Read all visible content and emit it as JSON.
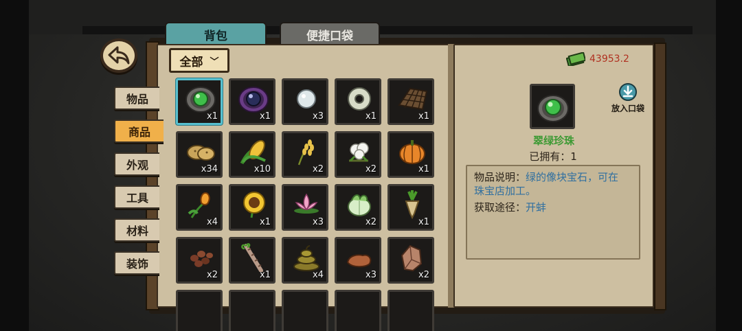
{
  "tabs": {
    "bag": "背包",
    "pocket": "便捷口袋"
  },
  "side_tabs": [
    "物品",
    "商品",
    "外观",
    "工具",
    "材料",
    "装饰"
  ],
  "active_side_tab": "商品",
  "filter": {
    "label": "全部"
  },
  "money": {
    "value": "43953.2"
  },
  "items": [
    {
      "icon": "green-pearl-icon",
      "count": "x1"
    },
    {
      "icon": "black-pearl-icon",
      "count": "x1"
    },
    {
      "icon": "white-pearl-icon",
      "count": "x3"
    },
    {
      "icon": "jade-disc-icon",
      "count": "x1"
    },
    {
      "icon": "net-icon",
      "count": "x1"
    },
    {
      "icon": "potato-icon",
      "count": "x34"
    },
    {
      "icon": "corn-icon",
      "count": "x10"
    },
    {
      "icon": "wheat-icon",
      "count": "x2"
    },
    {
      "icon": "cotton-icon",
      "count": "x2"
    },
    {
      "icon": "pumpkin-icon",
      "count": "x1"
    },
    {
      "icon": "tulip-icon",
      "count": "x4"
    },
    {
      "icon": "sunflower-icon",
      "count": "x1"
    },
    {
      "icon": "lotus-icon",
      "count": "x3"
    },
    {
      "icon": "cabbage-icon",
      "count": "x2"
    },
    {
      "icon": "radish-icon",
      "count": "x1"
    },
    {
      "icon": "beans-icon",
      "count": "x2"
    },
    {
      "icon": "sugarcane-icon",
      "count": "x1"
    },
    {
      "icon": "dung-icon",
      "count": "x4"
    },
    {
      "icon": "clay-icon",
      "count": "x3"
    },
    {
      "icon": "ore-icon",
      "count": "x2"
    }
  ],
  "detail": {
    "name": "翠绿珍珠",
    "owned": "已拥有：1",
    "pocket_button": "放入口袋",
    "desc_label": "物品说明：",
    "desc_text_1": "绿的像块宝石，可在",
    "desc_text_2": "珠宝店加工。",
    "source_label": "获取途径：",
    "source_value": "开蚌"
  },
  "colors": {
    "accent_teal": "#5aa2a3",
    "active_tab": "#f0b04a",
    "money": "#b03020",
    "item_name": "#3d9a34",
    "highlight": "#2f6fa0"
  }
}
